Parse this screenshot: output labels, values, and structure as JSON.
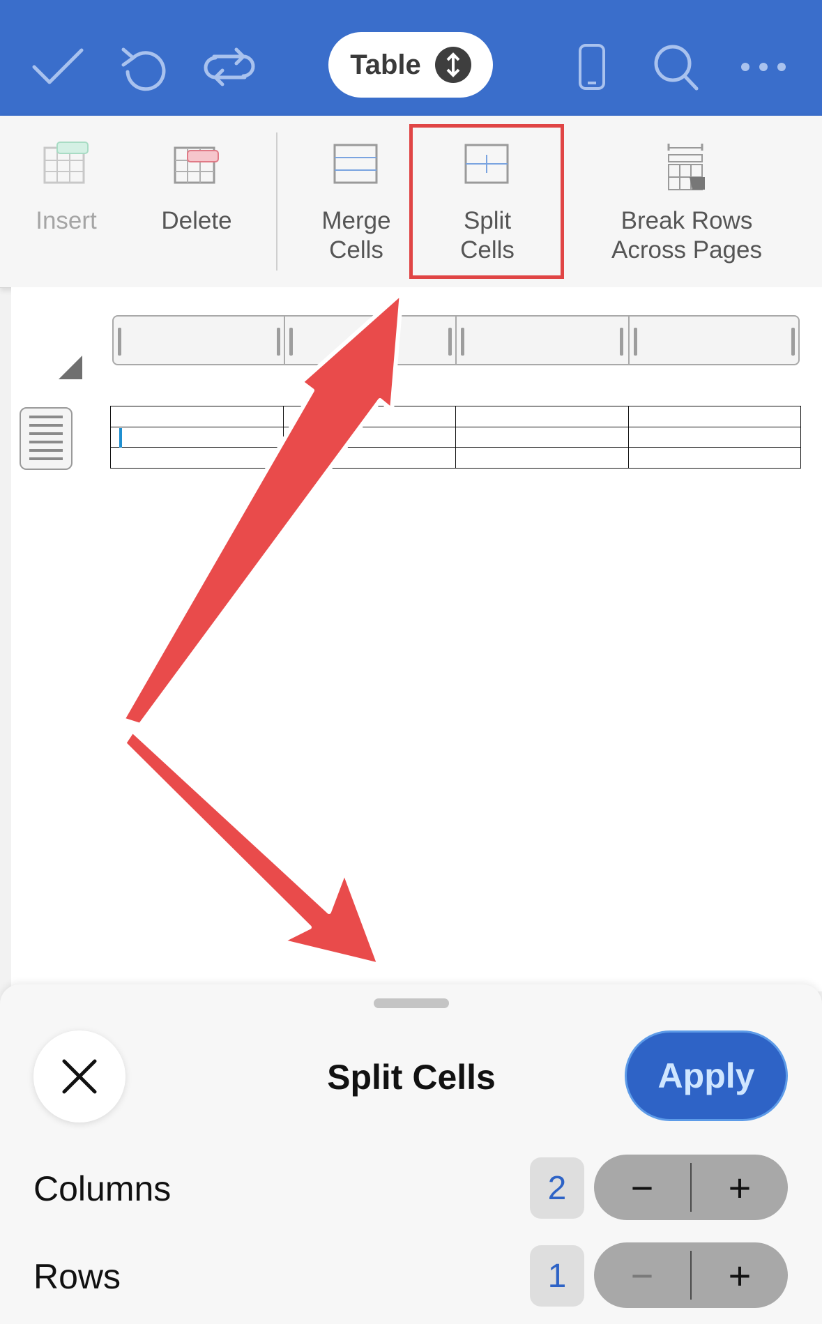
{
  "topbar": {
    "table_label": "Table",
    "icons": [
      "check-icon",
      "undo-icon",
      "redo-icon",
      "phone-layout-icon",
      "search-icon",
      "more-icon"
    ]
  },
  "ribbon": {
    "items": [
      {
        "label": "Insert",
        "icon": "insert-table-icon",
        "enabled": false
      },
      {
        "label": "Delete",
        "icon": "delete-table-icon",
        "enabled": true
      },
      {
        "label": "Merge\nCells",
        "icon": "merge-cells-icon",
        "enabled": true
      },
      {
        "label": "Split\nCells",
        "icon": "split-cells-icon",
        "enabled": true,
        "highlighted": true
      },
      {
        "label": "Break Rows\nAcross Pages",
        "icon": "break-rows-icon",
        "enabled": true
      }
    ]
  },
  "document": {
    "table": {
      "rows": 3,
      "columns": 4
    }
  },
  "sheet": {
    "title": "Split Cells",
    "apply_label": "Apply",
    "columns_label": "Columns",
    "columns_value": "2",
    "rows_label": "Rows",
    "rows_value": "1",
    "minus_symbol": "−",
    "plus_symbol": "+"
  },
  "colors": {
    "topbar": "#3a6ecb",
    "accent": "#2e63c6",
    "highlight": "#e04545",
    "annotation_arrow": "#e94b4b"
  }
}
